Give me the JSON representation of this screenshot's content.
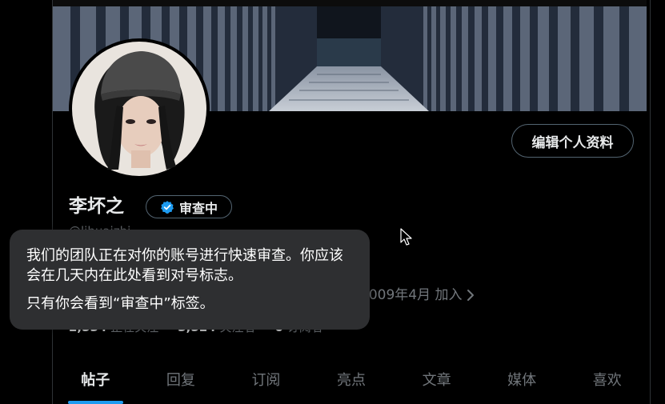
{
  "profile": {
    "name": "李坏之",
    "handle": "@lihuaizhi",
    "edit_profile_label": "编辑个人资料",
    "badge_label": "审查中",
    "joined": "2009年4月 加入",
    "stats": [
      {
        "count": "2,534",
        "label": "正在关注"
      },
      {
        "count": "3,524",
        "label": "关注者"
      },
      {
        "count": "0",
        "label": "订阅者"
      }
    ]
  },
  "tooltip": {
    "line1": "我们的团队正在对你的账号进行快速审查。你应该会在几天内在此处看到对号标志。",
    "line2": "只有你会看到“审查中”标签。"
  },
  "tabs": [
    {
      "label": "帖子",
      "active": true
    },
    {
      "label": "回复",
      "active": false
    },
    {
      "label": "订阅",
      "active": false
    },
    {
      "label": "亮点",
      "active": false
    },
    {
      "label": "文章",
      "active": false
    },
    {
      "label": "媒体",
      "active": false
    },
    {
      "label": "喜欢",
      "active": false
    }
  ],
  "colors": {
    "background": "#000000",
    "accent": "#1d9bf0",
    "tooltip_bg": "#2e2f31",
    "muted_text": "#71767b"
  },
  "icons": {
    "badge": "verified-check-icon",
    "joined_more": "chevron-right-icon"
  }
}
